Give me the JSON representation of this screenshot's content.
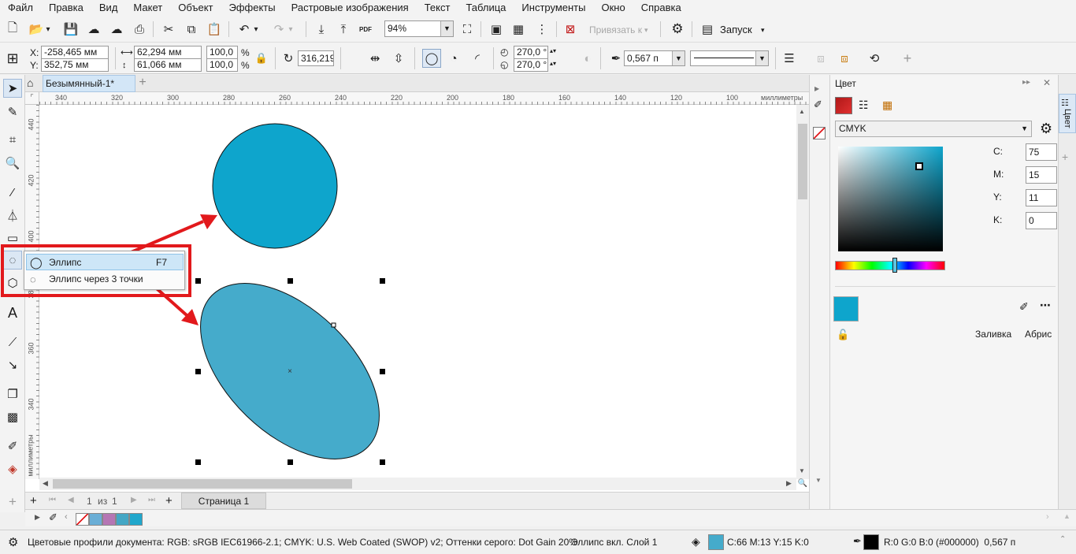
{
  "menu": [
    "Файл",
    "Правка",
    "Вид",
    "Макет",
    "Объект",
    "Эффекты",
    "Растровые изображения",
    "Текст",
    "Таблица",
    "Инструменты",
    "Окно",
    "Справка"
  ],
  "toolbar": {
    "zoom_value": "94%",
    "snap_label": "Привязать к",
    "launch_label": "Запуск",
    "pdf_label": "PDF"
  },
  "properties": {
    "x_label": "X:",
    "x_value": "-258,465 мм",
    "y_label": "Y:",
    "y_value": "352,75 мм",
    "width_value": "62,294 мм",
    "height_value": "61,066 мм",
    "scale_w": "100,0",
    "scale_h": "100,0",
    "percent": "%",
    "rotation": "316,219",
    "start_angle": "270,0 °",
    "end_angle": "270,0 °",
    "outline_width": "0,567 п"
  },
  "document_tab": "Безымянный-1*",
  "ruler": {
    "h_ticks": [
      "340",
      "320",
      "300",
      "280",
      "260",
      "240",
      "220",
      "200",
      "180",
      "160",
      "140",
      "120",
      "100"
    ],
    "h_unit": "миллиметры",
    "v_ticks": [
      "440",
      "420",
      "400",
      "380",
      "360",
      "340"
    ],
    "v_unit": "миллиметры"
  },
  "flyout": {
    "items": [
      {
        "label": "Эллипс",
        "shortcut": "F7"
      },
      {
        "label": "Эллипс через 3 точки",
        "shortcut": ""
      }
    ]
  },
  "page_nav": {
    "position": "1",
    "of": "из",
    "total": "1",
    "page_tab": "Страница 1"
  },
  "docker": {
    "title": "Цвет",
    "model": "CMYK",
    "c_label": "C:",
    "c_value": "75",
    "m_label": "M:",
    "m_value": "15",
    "y_label": "Y:",
    "y_value": "11",
    "k_label": "K:",
    "k_value": "0",
    "fill_label": "Заливка",
    "outline_label": "Абрис",
    "side_tab": "Цвет"
  },
  "colors": {
    "circle_fill": "#0ea5cc",
    "ellipse_fill": "#45abcb",
    "current_swatch": "#0ea5cc",
    "annotation_red": "#e2191c",
    "palette": [
      "#6aaed6",
      "#b576b4",
      "#44a7c5",
      "#20a7cc"
    ]
  },
  "status": {
    "profiles": "Цветовые профили документа: RGB: sRGB IEC61966-2.1; CMYK: U.S. Web Coated (SWOP) v2; Оттенки серого: Dot Gain 20%",
    "object_info": "Эллипс вкл. Слой 1",
    "fill_info": "C:66 M:13 Y:15 K:0",
    "outline_info": "R:0 G:0 B:0 (#000000)  0,567 п"
  }
}
